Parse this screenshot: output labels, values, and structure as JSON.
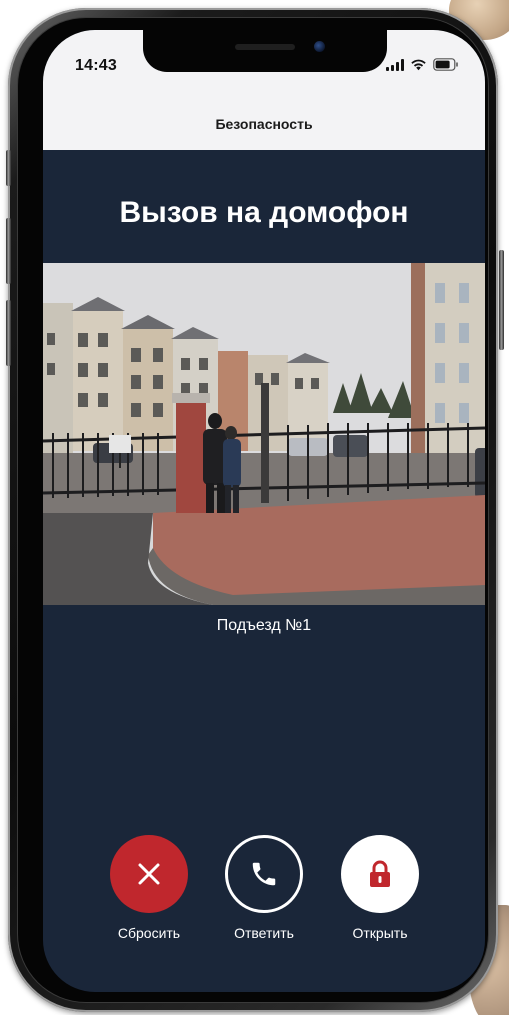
{
  "status_bar": {
    "time": "14:43",
    "icons": [
      "signal-icon",
      "wifi-icon",
      "battery-icon"
    ]
  },
  "nav": {
    "title": "Безопасность"
  },
  "call": {
    "title": "Вызов на домофон",
    "camera_label": "Подъезд №1"
  },
  "actions": [
    {
      "icon": "close-icon",
      "label": "Сбросить",
      "color": "#c0272d"
    },
    {
      "icon": "phone-icon",
      "label": "Ответить",
      "color": "#1a2639"
    },
    {
      "icon": "lock-icon",
      "label": "Открыть",
      "color": "#ffffff"
    }
  ],
  "colors": {
    "screen_background": "#1a2639",
    "top_bar_background": "#f3f3f5",
    "decline": "#c0272d",
    "open_icon": "#c0272d"
  }
}
